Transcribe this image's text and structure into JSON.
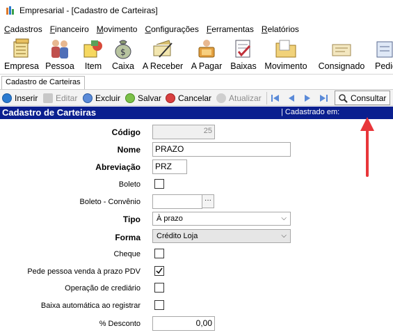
{
  "window": {
    "title": "Empresarial - [Cadastro de Carteiras]"
  },
  "menu": [
    {
      "first": "C",
      "rest": "adastros"
    },
    {
      "first": "F",
      "rest": "inanceiro"
    },
    {
      "first": "M",
      "rest": "ovimento"
    },
    {
      "first": "C",
      "rest": "onfigurações"
    },
    {
      "first": "F",
      "rest": "erramentas"
    },
    {
      "first": "R",
      "rest": "elatórios"
    }
  ],
  "big_toolbar": [
    {
      "label": "Empresa",
      "icon": "empresa-icon"
    },
    {
      "label": "Pessoa",
      "icon": "pessoa-icon"
    },
    {
      "label": "Item",
      "icon": "item-icon"
    },
    {
      "label": "Caixa",
      "icon": "caixa-icon"
    },
    {
      "label": "A Receber",
      "icon": "a-receber-icon"
    },
    {
      "label": "A Pagar",
      "icon": "a-pagar-icon"
    },
    {
      "label": "Baixas",
      "icon": "baixas-icon"
    },
    {
      "label": "Movimento",
      "icon": "movimento-icon"
    },
    {
      "label": "Consignado",
      "icon": "consignado-icon"
    },
    {
      "label": "Pedid",
      "icon": "pedido-icon"
    }
  ],
  "tab": {
    "label": "Cadastro de Carteiras"
  },
  "actions": {
    "inserir": "Inserir",
    "editar": "Editar",
    "excluir": "Excluir",
    "salvar": "Salvar",
    "cancelar": "Cancelar",
    "atualizar": "Atualizar",
    "consultar": "Consultar"
  },
  "header": {
    "title": "Cadastro de Carteiras",
    "status": "| Cadastrado em:"
  },
  "form": {
    "codigo": {
      "label": "Código",
      "value": "25"
    },
    "nome": {
      "label": "Nome",
      "value": "PRAZO"
    },
    "abreviacao": {
      "label": "Abreviação",
      "value": "PRZ"
    },
    "boleto": {
      "label": "Boleto",
      "checked": false
    },
    "boleto_convenio": {
      "label": "Boleto - Convênio",
      "value": "",
      "button": "···"
    },
    "tipo": {
      "label": "Tipo",
      "value": "À prazo"
    },
    "forma": {
      "label": "Forma",
      "value": "Crédito Loja"
    },
    "cheque": {
      "label": "Cheque",
      "checked": false
    },
    "pede_pessoa": {
      "label": "Pede pessoa venda à prazo PDV",
      "checked": true
    },
    "operacao_crediario": {
      "label": "Operação de crediário",
      "checked": false
    },
    "baixa_automatica": {
      "label": "Baixa automática ao registrar",
      "checked": false
    },
    "desconto": {
      "label": "% Desconto",
      "value": "0,00"
    }
  },
  "colors": {
    "header_bg": "#0a1f8f",
    "arrow": "#e8363a"
  }
}
